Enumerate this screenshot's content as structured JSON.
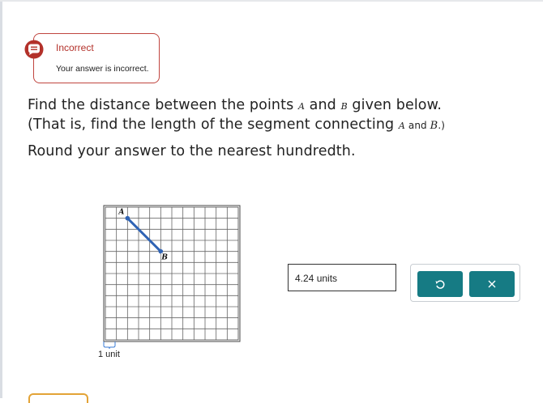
{
  "feedback": {
    "title": "Incorrect",
    "message": "Your answer is incorrect.",
    "icon": "speech-bubble-alert-icon",
    "color": "#b3312a"
  },
  "question": {
    "line1_a": "Find the distance between the points ",
    "point_a": "A",
    "line1_and": " and ",
    "point_b": "B",
    "line1_b": " given below.",
    "line2_a": "(That is, find the length of the segment connecting ",
    "line2_and": " and ",
    "line2_end": ".)",
    "line3": "Round your answer to the nearest hundredth."
  },
  "graph": {
    "point_a_label": "A",
    "point_b_label": "B",
    "scale_label": "1 unit",
    "grid_cols": 12,
    "grid_rows": 12,
    "point_a": [
      2,
      11
    ],
    "point_b": [
      5,
      8
    ],
    "segment_color": "#2f63b5"
  },
  "answer": {
    "value": "4.24",
    "unit": "units"
  },
  "buttons": {
    "undo_icon": "undo-icon",
    "clear_icon": "close-icon",
    "accent": "#167b84"
  }
}
